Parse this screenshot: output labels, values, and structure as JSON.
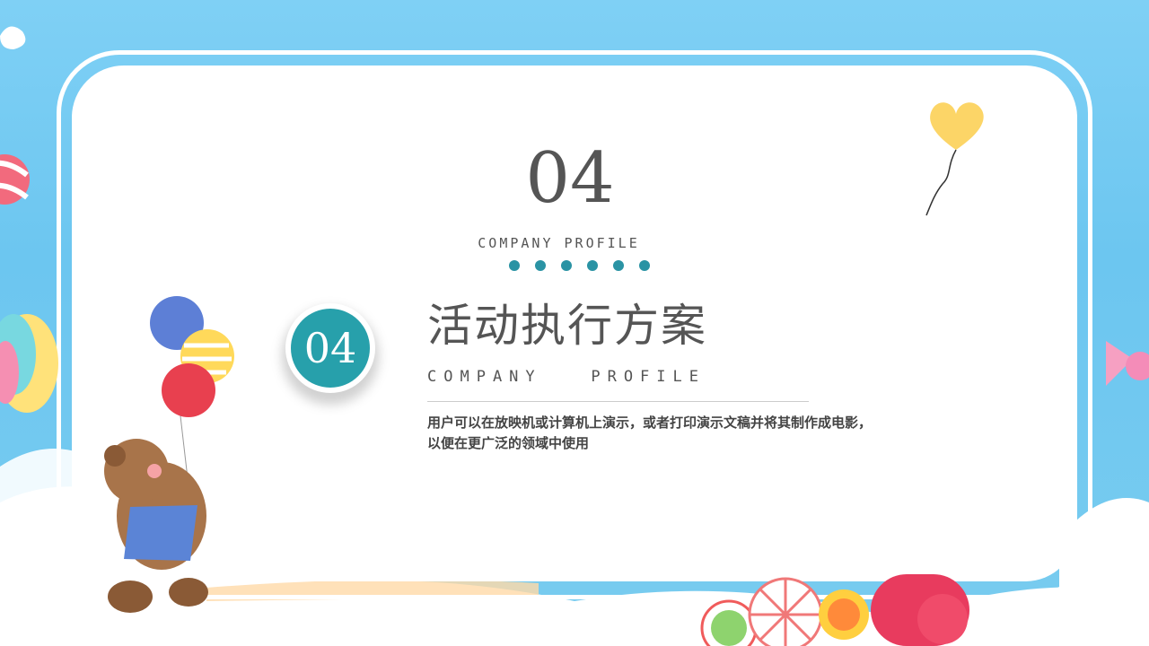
{
  "section": {
    "number": "04",
    "subtitle_top": "COMPANY PROFILE",
    "dot_count": 6,
    "badge_number": "04",
    "title": "活动执行方案",
    "subtitle_mid": "COMPANY   PROFILE",
    "description_line1": "用户可以在放映机或计算机上演示，或者打印演示文稿并将其制作成电影，",
    "description_line2": "以便在更广泛的领域中使用"
  },
  "colors": {
    "accent": "#27a0ab",
    "dots": "#2a93a4",
    "text": "#555555",
    "background": "#7fd0f5"
  }
}
